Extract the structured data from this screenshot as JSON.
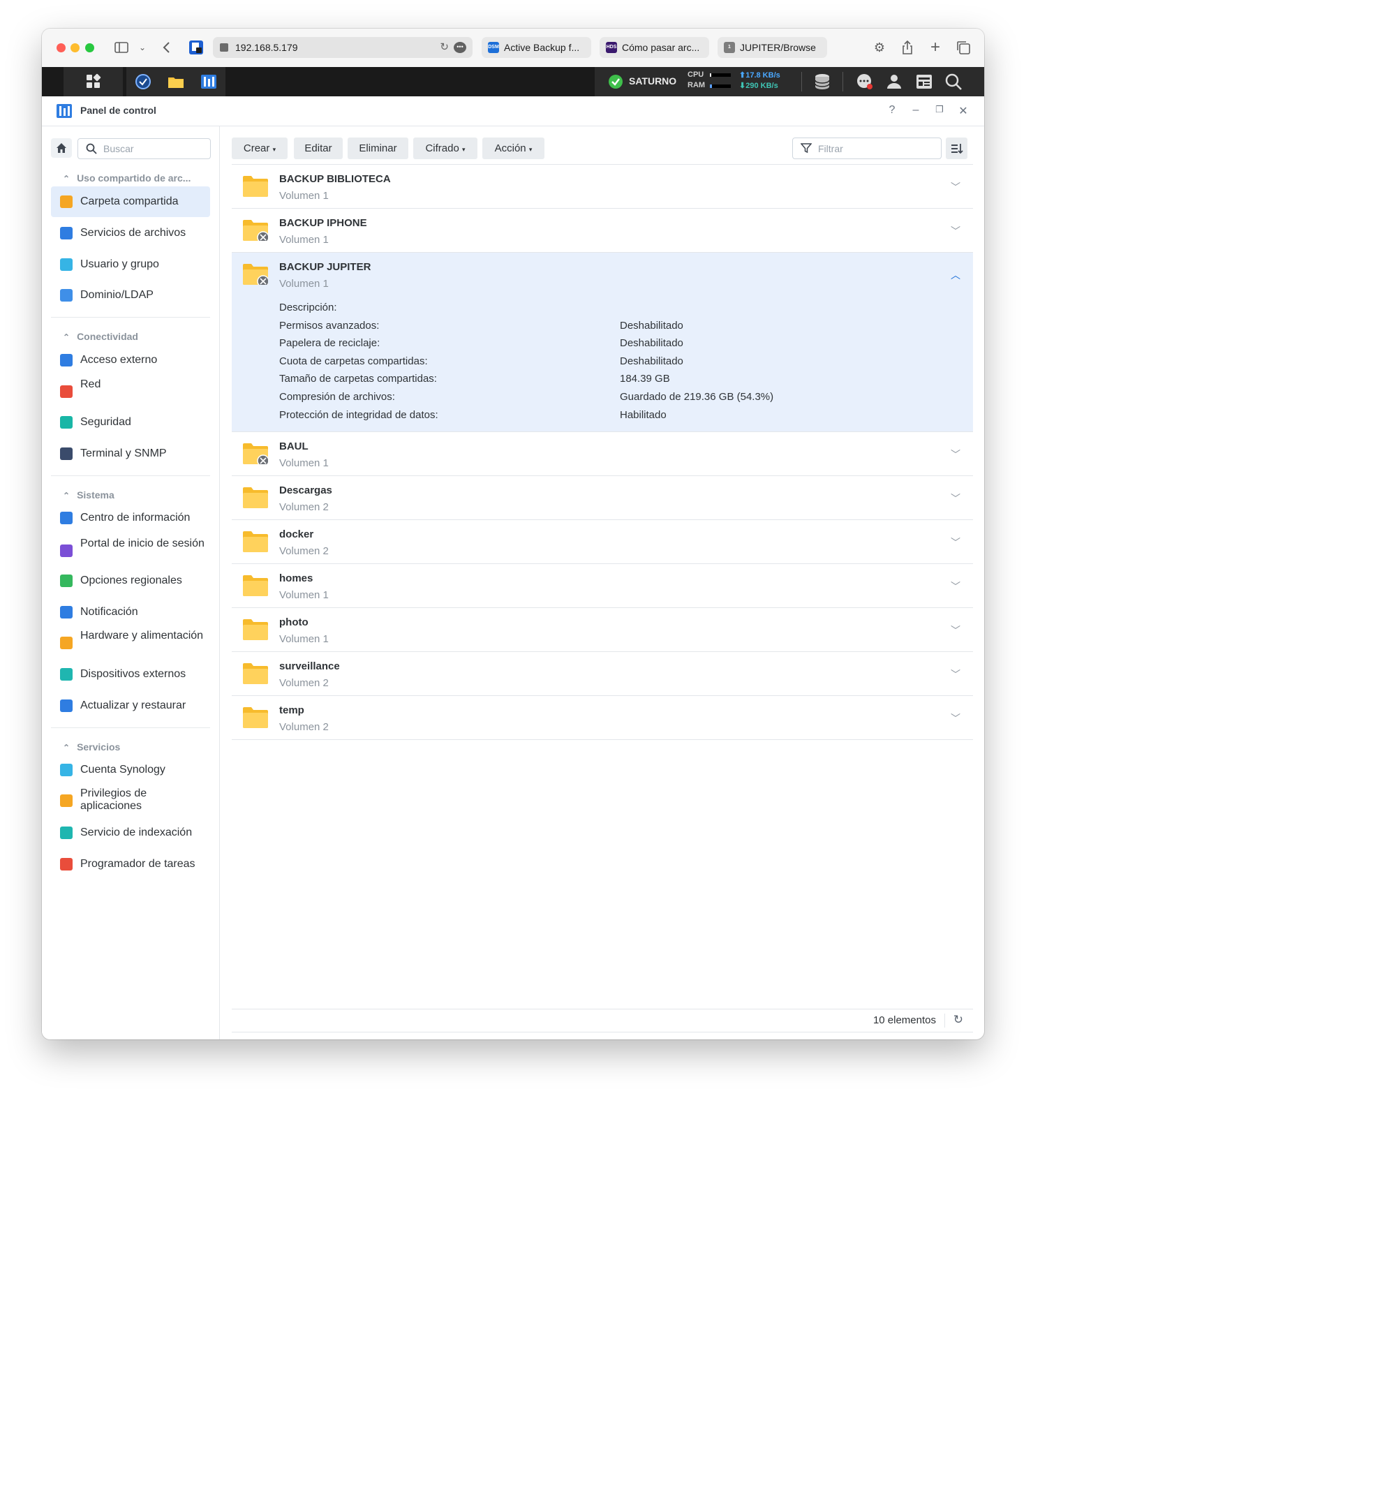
{
  "browser": {
    "url": "192.168.5.179",
    "tabs": [
      {
        "title": "Active Backup f...",
        "icon_text": "DSM",
        "icon_color": "#1d6fd8"
      },
      {
        "title": "Cómo pasar arc...",
        "icon_text": "HDS",
        "icon_color": "#3b1a6e"
      },
      {
        "title": "JUPITER/Browse",
        "icon_text": "1",
        "icon_color": "#7d7d7d"
      }
    ]
  },
  "dsm": {
    "server_name": "SATURNO",
    "cpu_label": "CPU",
    "ram_label": "RAM",
    "upload": "17.8 KB/s",
    "download": "290 KB/s"
  },
  "window": {
    "title": "Panel de control"
  },
  "sidebar": {
    "search_placeholder": "Buscar",
    "sections": [
      {
        "title": "Uso compartido de arc...",
        "items": [
          {
            "label": "Carpeta compartida",
            "icon": "shared-folder-icon",
            "color": "#f5a623",
            "active": true
          },
          {
            "label": "Servicios de archivos",
            "icon": "file-services-icon",
            "color": "#2f7de1"
          },
          {
            "label": "Usuario y grupo",
            "icon": "user-group-icon",
            "color": "#36b4e5"
          },
          {
            "label": "Dominio/LDAP",
            "icon": "domain-ldap-icon",
            "color": "#3f8fe8"
          }
        ]
      },
      {
        "title": "Conectividad",
        "items": [
          {
            "label": "Acceso externo",
            "icon": "external-access-icon",
            "color": "#2f7de1"
          },
          {
            "label": "Red",
            "icon": "network-icon",
            "color": "#e94d3b"
          },
          {
            "label": "Seguridad",
            "icon": "security-icon",
            "color": "#19b6a6"
          },
          {
            "label": "Terminal y SNMP",
            "icon": "terminal-icon",
            "color": "#3a4b6b"
          }
        ]
      },
      {
        "title": "Sistema",
        "items": [
          {
            "label": "Centro de información",
            "icon": "info-center-icon",
            "color": "#2f7de1"
          },
          {
            "label": "Portal de inicio de sesión",
            "icon": "login-portal-icon",
            "color": "#7b4fd6"
          },
          {
            "label": "Opciones regionales",
            "icon": "regional-options-icon",
            "color": "#35b85e"
          },
          {
            "label": "Notificación",
            "icon": "notification-icon",
            "color": "#2f7de1"
          },
          {
            "label": "Hardware y alimentación",
            "icon": "hardware-power-icon",
            "color": "#f5a623"
          },
          {
            "label": "Dispositivos externos",
            "icon": "external-devices-icon",
            "color": "#1fb6b0"
          },
          {
            "label": "Actualizar y restaurar",
            "icon": "update-restore-icon",
            "color": "#2f7de1"
          }
        ]
      },
      {
        "title": "Servicios",
        "items": [
          {
            "label": "Cuenta Synology",
            "icon": "synology-account-icon",
            "color": "#36b4e5"
          },
          {
            "label": "Privilegios de aplicaciones",
            "icon": "app-privileges-icon",
            "color": "#f5a623"
          },
          {
            "label": "Servicio de indexación",
            "icon": "indexing-service-icon",
            "color": "#1fb6b0"
          },
          {
            "label": "Programador de tareas",
            "icon": "task-scheduler-icon",
            "color": "#e94d3b"
          }
        ]
      }
    ]
  },
  "toolbar": {
    "crear": "Crear",
    "editar": "Editar",
    "eliminar": "Eliminar",
    "cifrado": "Cifrado",
    "accion": "Acción",
    "filter_placeholder": "Filtrar"
  },
  "folders": [
    {
      "name": "BACKUP BIBLIOTECA",
      "volume": "Volumen 1",
      "badge": false
    },
    {
      "name": "BACKUP IPHONE",
      "volume": "Volumen 1",
      "badge": true
    },
    {
      "name": "BACKUP JUPITER",
      "volume": "Volumen 1",
      "badge": true,
      "expanded": true
    },
    {
      "name": "BAUL",
      "volume": "Volumen 1",
      "badge": true
    },
    {
      "name": "Descargas",
      "volume": "Volumen 2",
      "badge": false
    },
    {
      "name": "docker",
      "volume": "Volumen 2",
      "badge": false
    },
    {
      "name": "homes",
      "volume": "Volumen 1",
      "badge": false
    },
    {
      "name": "photo",
      "volume": "Volumen 1",
      "badge": false
    },
    {
      "name": "surveillance",
      "volume": "Volumen 2",
      "badge": false
    },
    {
      "name": "temp",
      "volume": "Volumen 2",
      "badge": false
    }
  ],
  "details": [
    {
      "label": "Descripción:",
      "value": ""
    },
    {
      "label": "Permisos avanzados:",
      "value": "Deshabilitado"
    },
    {
      "label": "Papelera de reciclaje:",
      "value": "Deshabilitado"
    },
    {
      "label": "Cuota de carpetas compartidas:",
      "value": "Deshabilitado"
    },
    {
      "label": "Tamaño de carpetas compartidas:",
      "value": "184.39 GB"
    },
    {
      "label": "Compresión de archivos:",
      "value": "Guardado de 219.36 GB (54.3%)"
    },
    {
      "label": "Protección de integridad de datos:",
      "value": "Habilitado"
    }
  ],
  "footer": {
    "count": "10 elementos"
  }
}
